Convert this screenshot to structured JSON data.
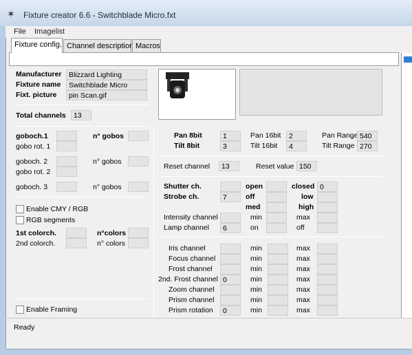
{
  "window": {
    "title": "Fixture creator 6.6 - Switchblade Micro.fxt",
    "status": "Ready"
  },
  "menu": {
    "file": "File",
    "imagelist": "Imagelist"
  },
  "tabs": {
    "fixture_config": "Fixture config.",
    "channel_description": "Channel description",
    "macros": "Macros"
  },
  "info": {
    "manufacturer_label": "Manufacturer",
    "manufacturer": "Blizzard Lighting",
    "fixture_name_label": "Fixture name",
    "fixture_name": "Switchblade Micro",
    "picture_label": "Fixt. picture",
    "picture": "pin Scan.gif",
    "total_channels_label": "Total channels",
    "total_channels": "13"
  },
  "gobo": {
    "goboch1": "goboch.1",
    "gobos_label_bold": "n° gobos",
    "gobo_rot1": "gobo rot. 1",
    "goboch2": "goboch. 2",
    "gobos_label2": "n° gobos",
    "gobo_rot2": "gobo rot. 2",
    "goboch3": "goboch. 3",
    "gobos_label3": "n° gobos"
  },
  "color": {
    "enable_cmy": "Enable CMY / RGB",
    "rgb_segments": "RGB segments",
    "colorch1": "1st colorch.",
    "ncolors_bold": "n°colors",
    "colorch2": "2nd colorch.",
    "ncolors": "n° colors",
    "enable_framing": "Enable Framing"
  },
  "pantilt": {
    "pan8": "Pan 8bit",
    "pan8_value": "1",
    "tilt8": "Tilt 8bit",
    "tilt8_value": "3",
    "pan16": "Pan 16bit",
    "pan16_value": "2",
    "tilt16": "Tilt 16bit",
    "tilt16_value": "4",
    "pan_range": "Pan Range",
    "pan_range_value": "540",
    "tilt_range": "Tilt Range",
    "tilt_range_value": "270"
  },
  "reset": {
    "channel_label": "Reset channel",
    "channel_value": "13",
    "value_label": "Reset value",
    "value": "150"
  },
  "shutter": {
    "shutter_ch": "Shutter ch.",
    "open": "open",
    "closed": "closed",
    "closed_value": "0",
    "strobe_ch": "Strobe ch.",
    "strobe_value": "7",
    "off": "off",
    "low": "low",
    "med": "med",
    "high": "high",
    "intensity": "Intensity channel",
    "min": "min",
    "max": "max",
    "lamp": "Lamp channel",
    "lamp_value": "6",
    "on": "on",
    "off2": "off"
  },
  "effects": {
    "iris": "Iris channel",
    "focus": "Focus channel",
    "frost": "Frost channel",
    "frost2": "2nd. Frost channel",
    "frost2_value": "0",
    "zoom": "Zoom channel",
    "prism": "Prism channel",
    "prism_rot": "Prism rotation",
    "prism_rot_value": "0",
    "min": "min",
    "max": "max"
  }
}
